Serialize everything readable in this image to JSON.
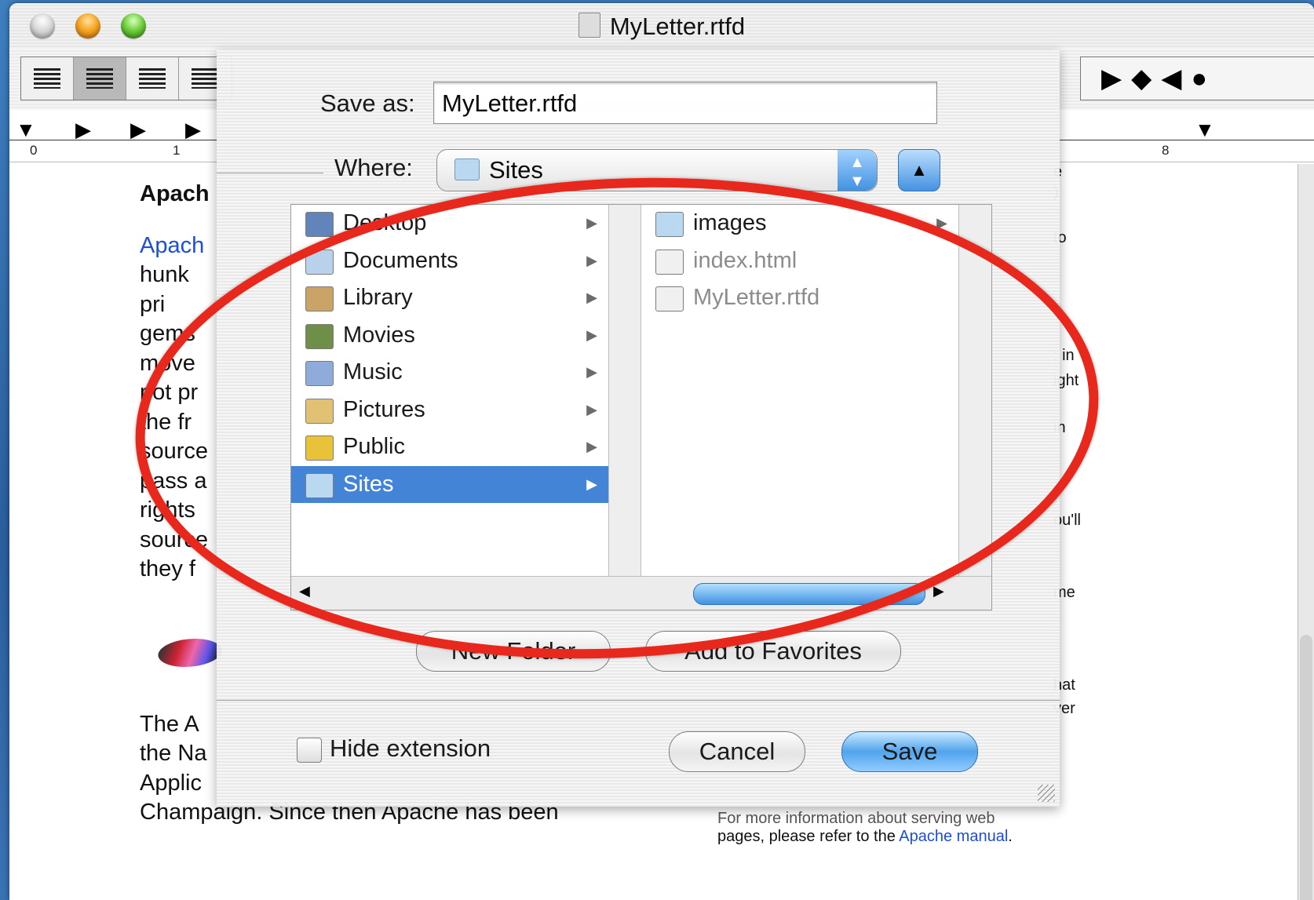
{
  "window": {
    "title": "MyLetter.rtfd"
  },
  "ruler": {
    "marks": [
      "0",
      "1",
      "8"
    ]
  },
  "document": {
    "heading_fragment": "Apach",
    "link_fragment": "Apach",
    "lines": [
      "hunk",
      "pri",
      "gems",
      "move",
      "not pr",
      "the fr",
      "source",
      "pass a",
      "rights",
      "source",
      "they f"
    ],
    "para2_lines": [
      "The A",
      "the Na",
      "Applic",
      "Champaign. Since then Apache has been"
    ],
    "right_col": [
      "e",
      ")",
      "to",
      "; in",
      "ight",
      "in",
      "ou'll",
      "me",
      "hat",
      "ver",
      "."
    ],
    "footer_line1": "For more information about serving web",
    "footer_line2_prefix": "pages, please refer to the ",
    "footer_link": "Apache manual",
    "footer_suffix": "."
  },
  "dialog": {
    "save_as_label": "Save as:",
    "save_as_value": "MyLetter.rtfd",
    "where_label": "Where:",
    "where_value": "Sites",
    "sidebar_items": [
      {
        "label": "Desktop",
        "color": "#5b7fb8"
      },
      {
        "label": "Documents",
        "color": "#b8d0ec"
      },
      {
        "label": "Library",
        "color": "#c8a060"
      },
      {
        "label": "Movies",
        "color": "#6a8a40"
      },
      {
        "label": "Music",
        "color": "#8aa8d8"
      },
      {
        "label": "Pictures",
        "color": "#e0c070"
      },
      {
        "label": "Public",
        "color": "#e8c030"
      },
      {
        "label": "Sites",
        "color": "#b8d8f0",
        "selected": true
      }
    ],
    "files": [
      {
        "label": "images",
        "kind": "folder"
      },
      {
        "label": "index.html",
        "kind": "file",
        "dim": true
      },
      {
        "label": "MyLetter.rtfd",
        "kind": "file",
        "dim": true
      }
    ],
    "new_folder_label": "New Folder",
    "add_favorites_label": "Add to Favorites",
    "hide_extension_label": "Hide extension",
    "cancel_label": "Cancel",
    "save_label": "Save"
  },
  "annotation": {
    "color": "#e8281c"
  }
}
